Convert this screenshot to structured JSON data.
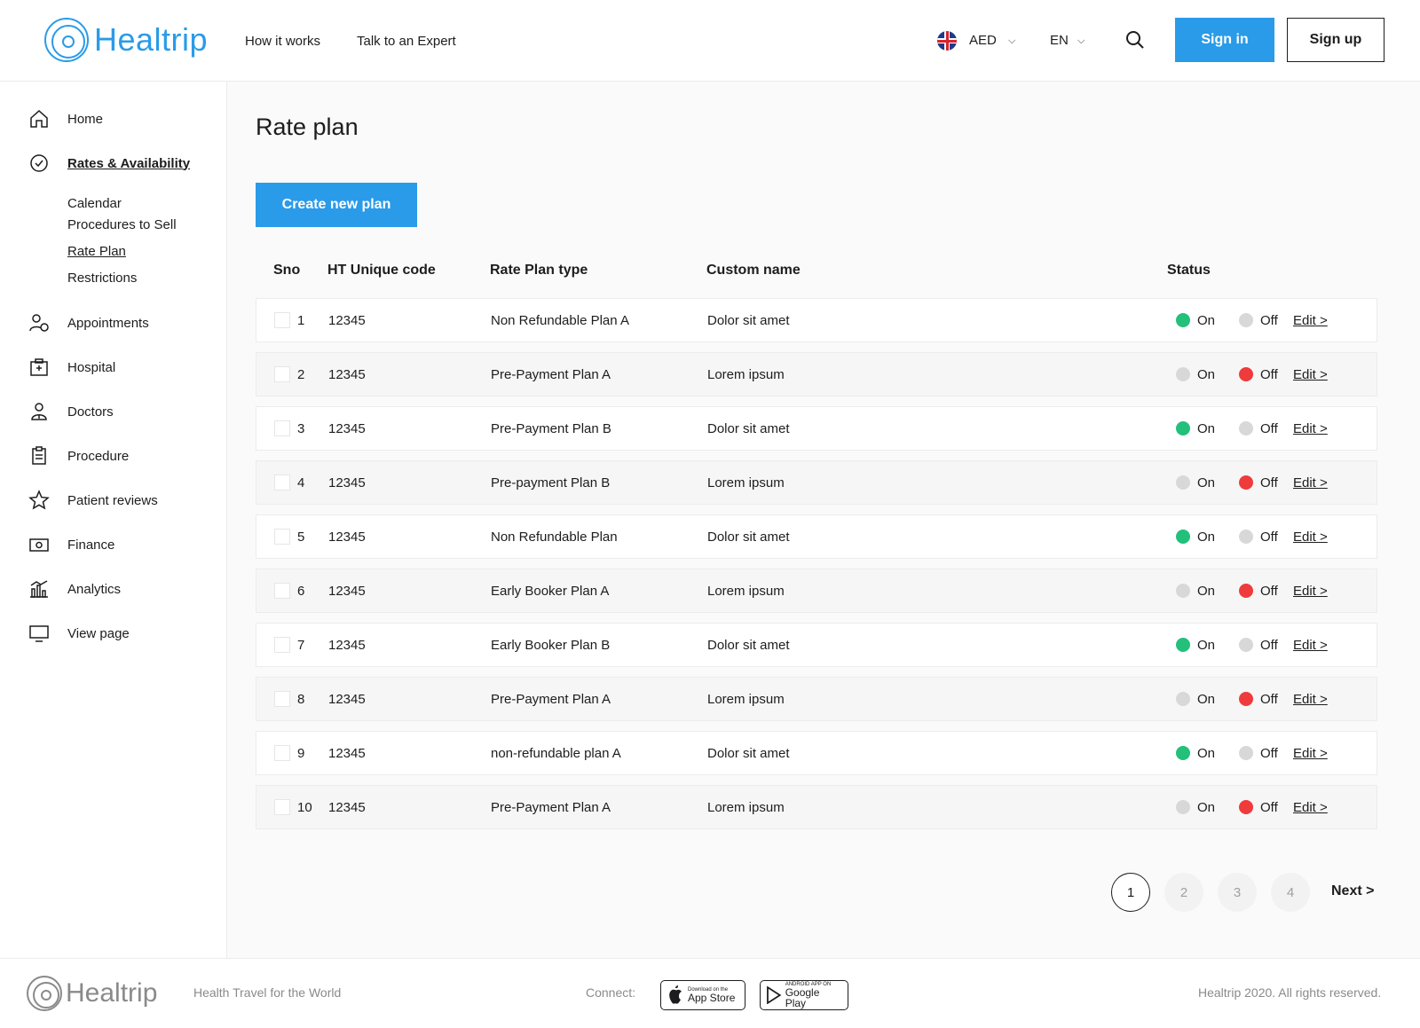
{
  "header": {
    "logo_text": "Healtrip",
    "nav": [
      "How it works",
      "Talk to an Expert"
    ],
    "currency": "AED",
    "language": "EN",
    "signin_label": "Sign in",
    "signup_label": "Sign up"
  },
  "sidebar": {
    "items": [
      {
        "label": "Home",
        "icon": "home-icon"
      },
      {
        "label": "Rates & Availability",
        "icon": "check-circle-icon"
      },
      {
        "label": "Appointments",
        "icon": "user-clock-icon"
      },
      {
        "label": "Hospital",
        "icon": "hospital-icon"
      },
      {
        "label": "Doctors",
        "icon": "doctor-icon"
      },
      {
        "label": "Procedure",
        "icon": "clipboard-icon"
      },
      {
        "label": "Patient reviews",
        "icon": "star-icon"
      },
      {
        "label": "Finance",
        "icon": "money-icon"
      },
      {
        "label": "Analytics",
        "icon": "analytics-icon"
      },
      {
        "label": "View page",
        "icon": "monitor-icon"
      }
    ],
    "subitems": [
      "Calendar",
      "Procedures to Sell",
      "Rate Plan",
      "Restrictions"
    ]
  },
  "main": {
    "title": "Rate plan",
    "create_label": "Create new plan",
    "columns": [
      "Sno",
      "HT Unique code",
      "Rate Plan type",
      "Custom name",
      "Status"
    ],
    "on_label": "On",
    "off_label": "Off",
    "edit_label": "Edit >",
    "rows": [
      {
        "sno": "1",
        "code": "12345",
        "type": "Non Refundable Plan A",
        "name": "Dolor sit amet",
        "status": "on"
      },
      {
        "sno": "2",
        "code": "12345",
        "type": "Pre-Payment Plan A",
        "name": "Lorem ipsum",
        "status": "off"
      },
      {
        "sno": "3",
        "code": "12345",
        "type": "Pre-Payment Plan B",
        "name": "Dolor sit amet",
        "status": "on"
      },
      {
        "sno": "4",
        "code": "12345",
        "type": "Pre-payment Plan B",
        "name": "Lorem ipsum",
        "status": "off"
      },
      {
        "sno": "5",
        "code": "12345",
        "type": "Non Refundable Plan",
        "name": "Dolor sit amet",
        "status": "on"
      },
      {
        "sno": "6",
        "code": "12345",
        "type": "Early Booker Plan A",
        "name": "Lorem ipsum",
        "status": "off"
      },
      {
        "sno": "7",
        "code": "12345",
        "type": "Early Booker Plan B",
        "name": "Dolor sit amet",
        "status": "on"
      },
      {
        "sno": "8",
        "code": "12345",
        "type": "Pre-Payment Plan A",
        "name": "Lorem ipsum",
        "status": "off"
      },
      {
        "sno": "9",
        "code": "12345",
        "type": "non-refundable plan A",
        "name": "Dolor sit amet",
        "status": "on"
      },
      {
        "sno": "10",
        "code": "12345",
        "type": "Pre-Payment Plan A",
        "name": "Lorem ipsum",
        "status": "off"
      }
    ],
    "pagination": {
      "pages": [
        "1",
        "2",
        "3",
        "4"
      ],
      "current": "1",
      "next_label": "Next >"
    }
  },
  "footer": {
    "logo_text": "Healtrip",
    "tagline": "Health Travel for the World",
    "connect_label": "Connect:",
    "appstore_small": "Download on the",
    "appstore_big": "App Store",
    "googleplay_small": "ANDROID APP ON",
    "googleplay_big": "Google Play",
    "copyright": "Healtrip 2020. All rights reserved."
  },
  "colors": {
    "accent": "#2a9be8",
    "on": "#22c07a",
    "off": "#ef3b3b",
    "inactive_dot": "#d8d8d8"
  }
}
